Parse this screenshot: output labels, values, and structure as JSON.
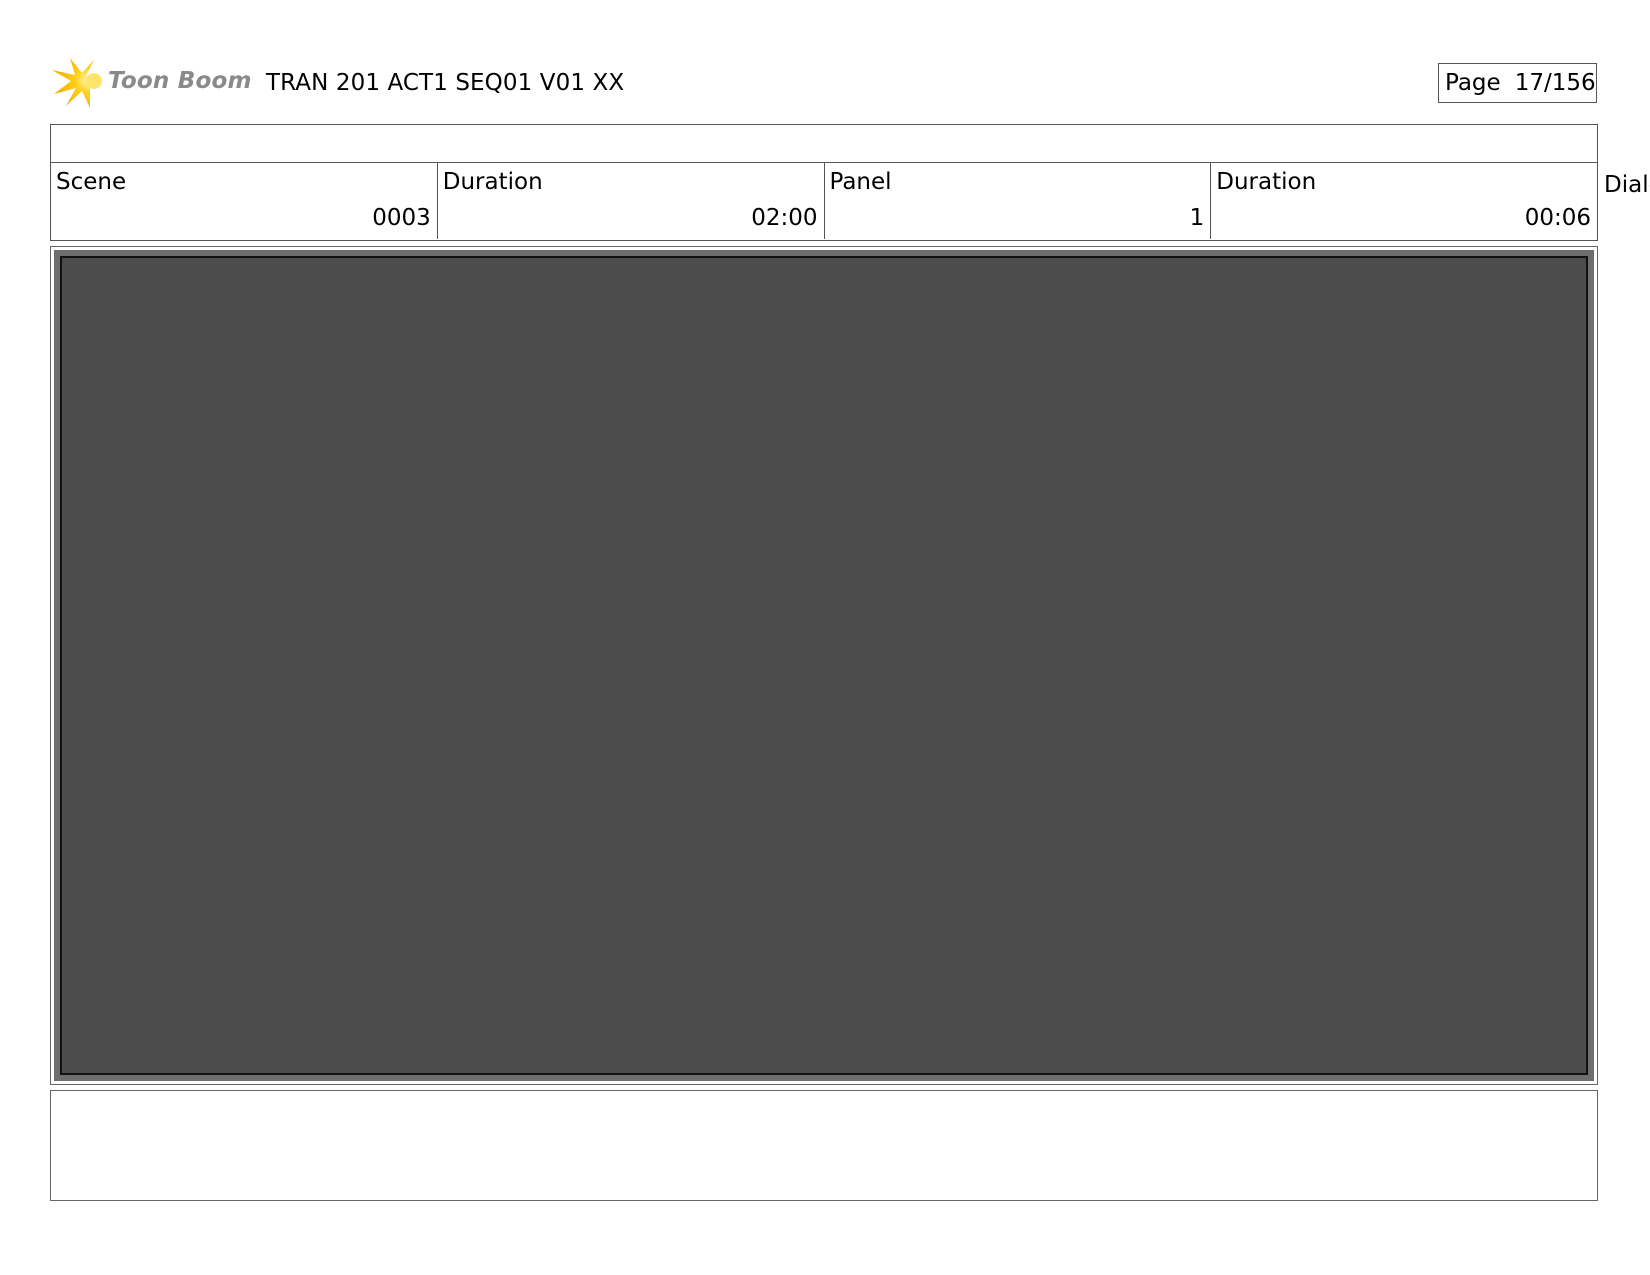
{
  "header": {
    "logo_text": "Toon Boom",
    "doc_title": "TRAN 201 ACT1 SEQ01 V01 XX",
    "page_label": "Page",
    "page_number": "17/156"
  },
  "info": {
    "top_row_text": "",
    "scene_label": "Scene",
    "scene_value": "0003",
    "scene_duration_label": "Duration",
    "scene_duration_value": "02:00",
    "panel_label": "Panel",
    "panel_value": "1",
    "panel_duration_label": "Duration",
    "panel_duration_value": "00:06",
    "overflow_label": "Dialo"
  },
  "panel": {
    "caption_text": ""
  },
  "colors": {
    "logo_star": "#f7c600",
    "logo_text": "#8a8a8a",
    "panel_frame": "#6e6e6e",
    "panel_fill": "#4c4c4c"
  }
}
